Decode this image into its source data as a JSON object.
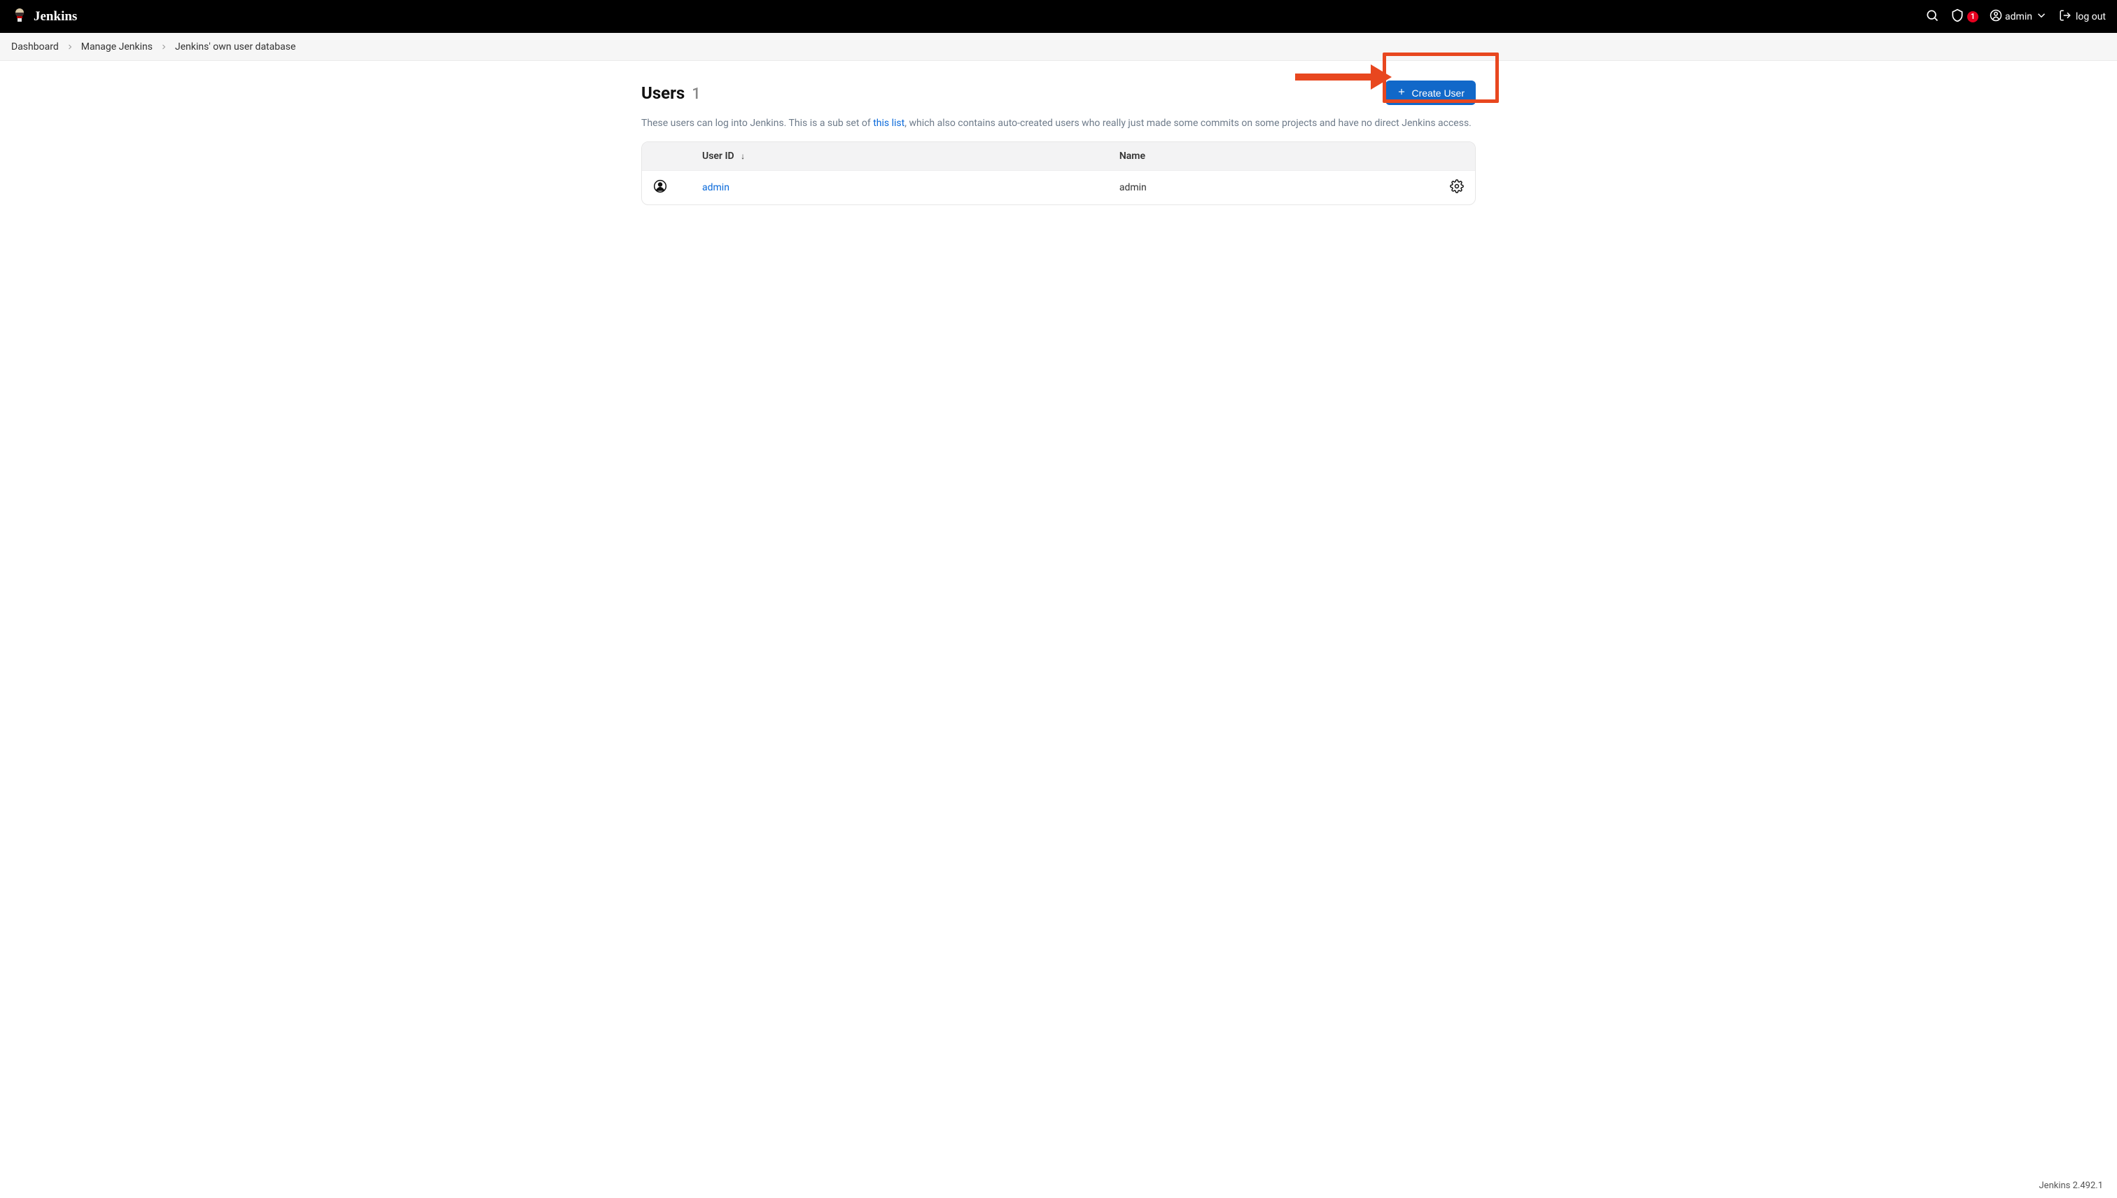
{
  "header": {
    "brand": "Jenkins",
    "alerts_count": "1",
    "username": "admin",
    "logout_label": "log out"
  },
  "breadcrumbs": {
    "items": [
      "Dashboard",
      "Manage Jenkins",
      "Jenkins' own user database"
    ]
  },
  "page": {
    "title": "Users",
    "count": "1",
    "create_button_label": "Create User",
    "description_prefix": "These users can log into Jenkins. This is a sub set of ",
    "description_link": "this list",
    "description_suffix": ", which also contains auto-created users who really just made some commits on some projects and have no direct Jenkins access."
  },
  "table": {
    "columns": {
      "user_id": "User ID",
      "name": "Name"
    },
    "sort_indicator": "↓",
    "rows": [
      {
        "user_id": "admin",
        "name": "admin"
      }
    ]
  },
  "footer": {
    "version": "Jenkins 2.492.1"
  }
}
